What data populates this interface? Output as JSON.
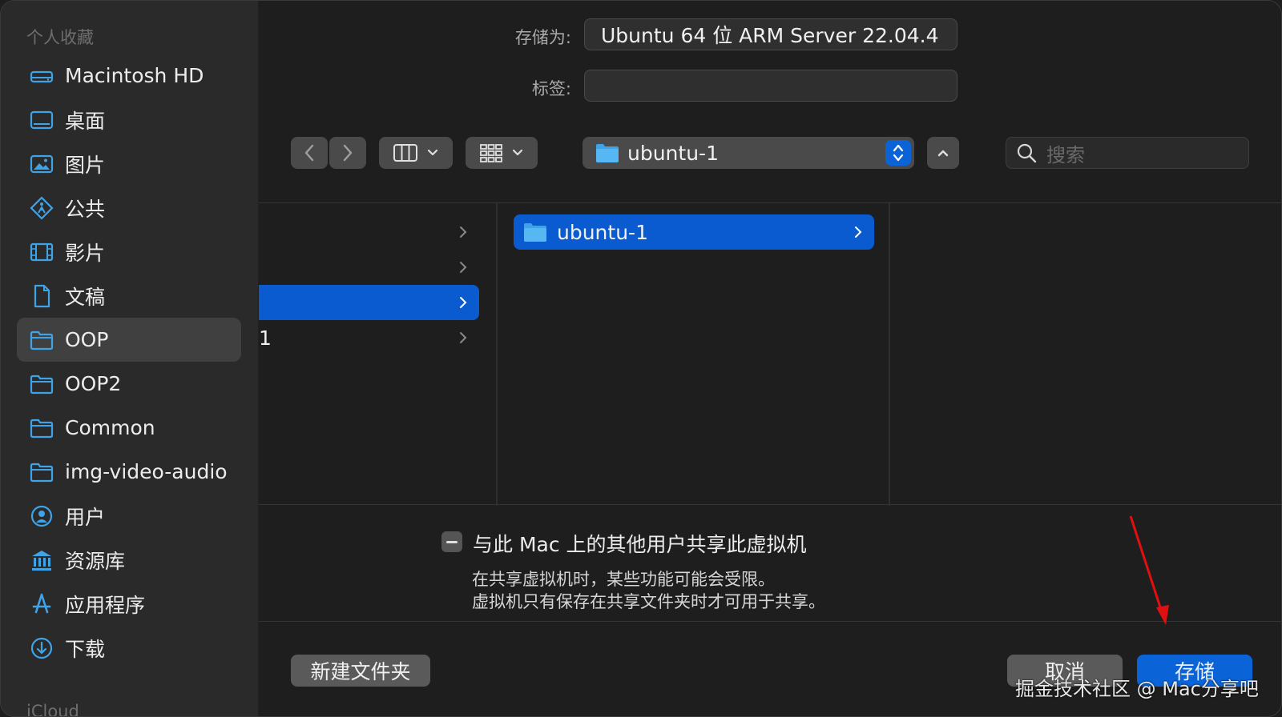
{
  "sidebar": {
    "section_favorites": "个人收藏",
    "section_icloud": "iCloud",
    "items": [
      {
        "label": "Macintosh HD",
        "icon": "drive-icon"
      },
      {
        "label": "桌面",
        "icon": "desktop-icon"
      },
      {
        "label": "图片",
        "icon": "photo-icon"
      },
      {
        "label": "公共",
        "icon": "public-icon"
      },
      {
        "label": "影片",
        "icon": "film-icon"
      },
      {
        "label": "文稿",
        "icon": "document-icon"
      },
      {
        "label": "OOP",
        "icon": "folder-icon",
        "selected": true
      },
      {
        "label": "OOP2",
        "icon": "folder-icon"
      },
      {
        "label": "Common",
        "icon": "folder-icon"
      },
      {
        "label": "img-video-audio",
        "icon": "folder-icon"
      },
      {
        "label": "用户",
        "icon": "user-icon"
      },
      {
        "label": "资源库",
        "icon": "library-icon"
      },
      {
        "label": "应用程序",
        "icon": "applications-icon"
      },
      {
        "label": "下载",
        "icon": "download-icon"
      }
    ]
  },
  "header": {
    "save_as_label": "存储为:",
    "save_as_value": "Ubuntu 64 位 ARM Server 22.04.4",
    "tags_label": "标签:",
    "tags_value": ""
  },
  "toolbar": {
    "path_folder": "ubuntu-1",
    "search_placeholder": "搜索"
  },
  "browser": {
    "col1_partial_text": "1",
    "col2_items": [
      "ubuntu-1"
    ]
  },
  "share": {
    "label": "与此 Mac 上的其他用户共享此虚拟机",
    "note_line1": "在共享虚拟机时，某些功能可能会受限。",
    "note_line2": "虚拟机只有保存在共享文件夹时才可用于共享。"
  },
  "buttons": {
    "new_folder": "新建文件夹",
    "cancel": "取消",
    "save": "存储"
  },
  "watermark": "掘金技术社区 @ Mac分享吧",
  "colors": {
    "accent": "#0a63d7",
    "selection": "#0a5bd0",
    "background": "#1e1e1e",
    "sidebar": "#2a2a2b",
    "folder_blue": "#3fa3e8",
    "annotation_arrow": "#e01010"
  }
}
